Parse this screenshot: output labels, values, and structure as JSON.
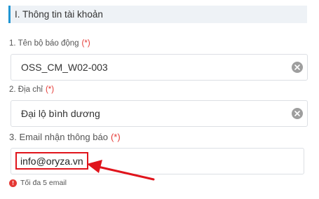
{
  "section": {
    "title": "I. Thông tin tài khoản"
  },
  "fields": [
    {
      "label": "1. Tên bộ báo động",
      "required_mark": "(*)",
      "value": "OSS_CM_W02-003"
    },
    {
      "label": "2. Địa chỉ",
      "required_mark": "(*)",
      "value": "Đại lộ bình dương"
    },
    {
      "label": "3. Email nhận thông báo",
      "required_mark": "(*)",
      "value": "info@oryza.vn"
    }
  ],
  "hint": {
    "icon": "!",
    "text": "Tối đa 5 email"
  },
  "colors": {
    "accent": "#2196d3",
    "required": "#e53935",
    "highlight": "#e0141c",
    "border": "#dcdfe4"
  }
}
